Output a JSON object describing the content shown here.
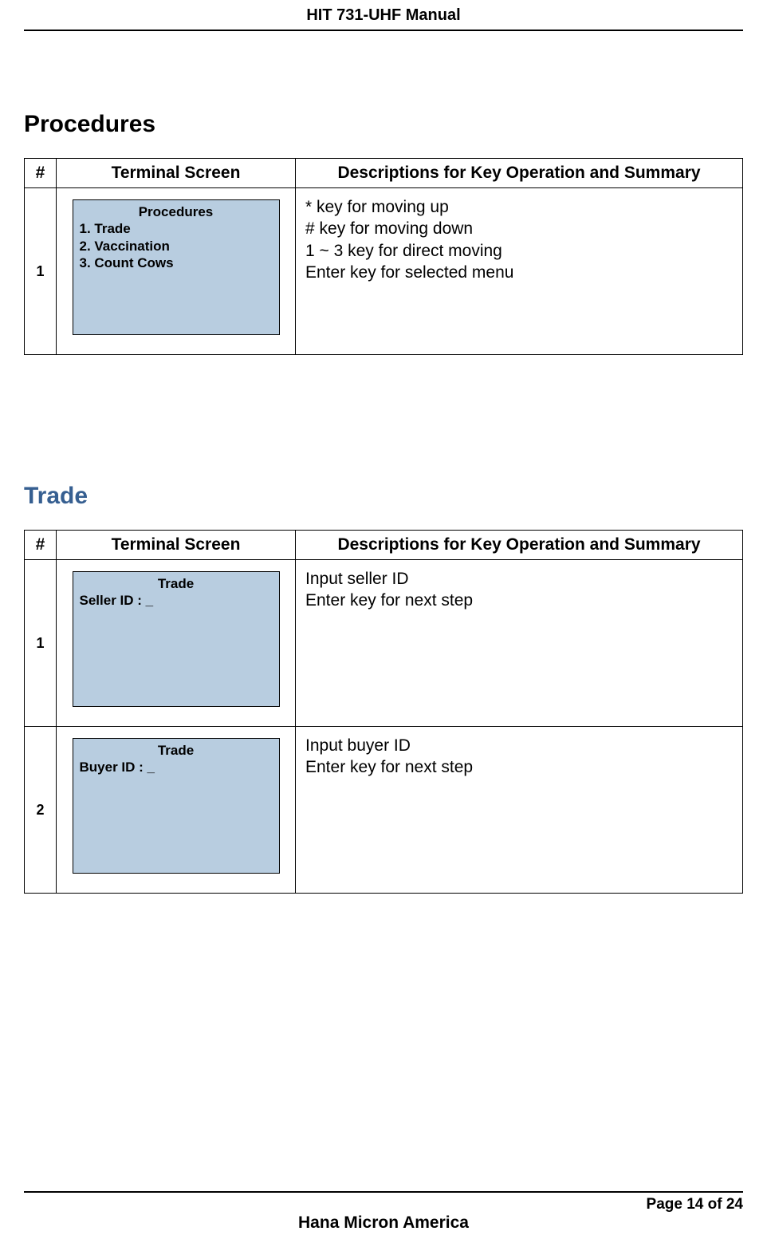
{
  "header": {
    "title": "HIT 731-UHF Manual"
  },
  "section1": {
    "heading": "Procedures",
    "table": {
      "headers": {
        "num": "#",
        "screen": "Terminal Screen",
        "desc": "Descriptions for Key Operation and Summary"
      },
      "rows": [
        {
          "num": "1",
          "terminal": {
            "title": "Procedures",
            "lines": [
              "1. Trade",
              "2. Vaccination",
              "3. Count Cows"
            ]
          },
          "desc": "* key for moving up\n# key for moving down\n1 ~ 3 key for direct moving\nEnter key for selected menu"
        }
      ]
    }
  },
  "section2": {
    "heading": "Trade",
    "table": {
      "headers": {
        "num": "#",
        "screen": "Terminal Screen",
        "desc": "Descriptions for Key Operation and Summary"
      },
      "rows": [
        {
          "num": "1",
          "terminal": {
            "title": "Trade",
            "lines": [
              "Seller ID : _"
            ]
          },
          "desc": "Input seller ID\nEnter key for next step"
        },
        {
          "num": "2",
          "terminal": {
            "title": "Trade",
            "lines": [
              "Buyer ID : _"
            ]
          },
          "desc": "Input buyer ID\nEnter key for next step"
        }
      ]
    }
  },
  "footer": {
    "page": "Page 14 of 24",
    "company": "Hana Micron America"
  }
}
